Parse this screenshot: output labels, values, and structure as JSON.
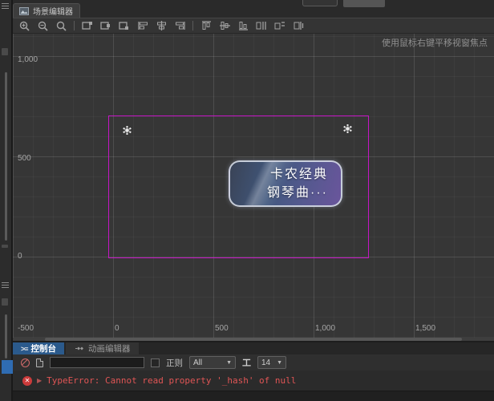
{
  "window": {
    "scene_tab": "场景编辑器",
    "hint": "使用鼠标右键平移视窗焦点"
  },
  "rulers": {
    "y": [
      "1,000",
      "500",
      "0"
    ],
    "x": [
      "-500",
      "0",
      "500",
      "1,000",
      "1,500"
    ]
  },
  "scene": {
    "button_line1": "卡农经典",
    "button_line2": "钢琴曲···",
    "selection_color": "#c515c5"
  },
  "console": {
    "tab_console": "控制台",
    "tab_animation": "动画编辑器",
    "filter_value": "",
    "regex_label": "正则",
    "level_value": "All",
    "font_size_value": "14",
    "error_message": "TypeError: Cannot read property '_hash' of null"
  },
  "icons": {
    "console_prompt": ">≡",
    "dropdown_arrow": "▼",
    "font_size": "工",
    "error_x": "✕",
    "expand_arrow": "▶"
  },
  "colors": {
    "console_tab_active": "#2b5a8c",
    "error_text": "#e05555",
    "canvas_bg": "#363636"
  }
}
